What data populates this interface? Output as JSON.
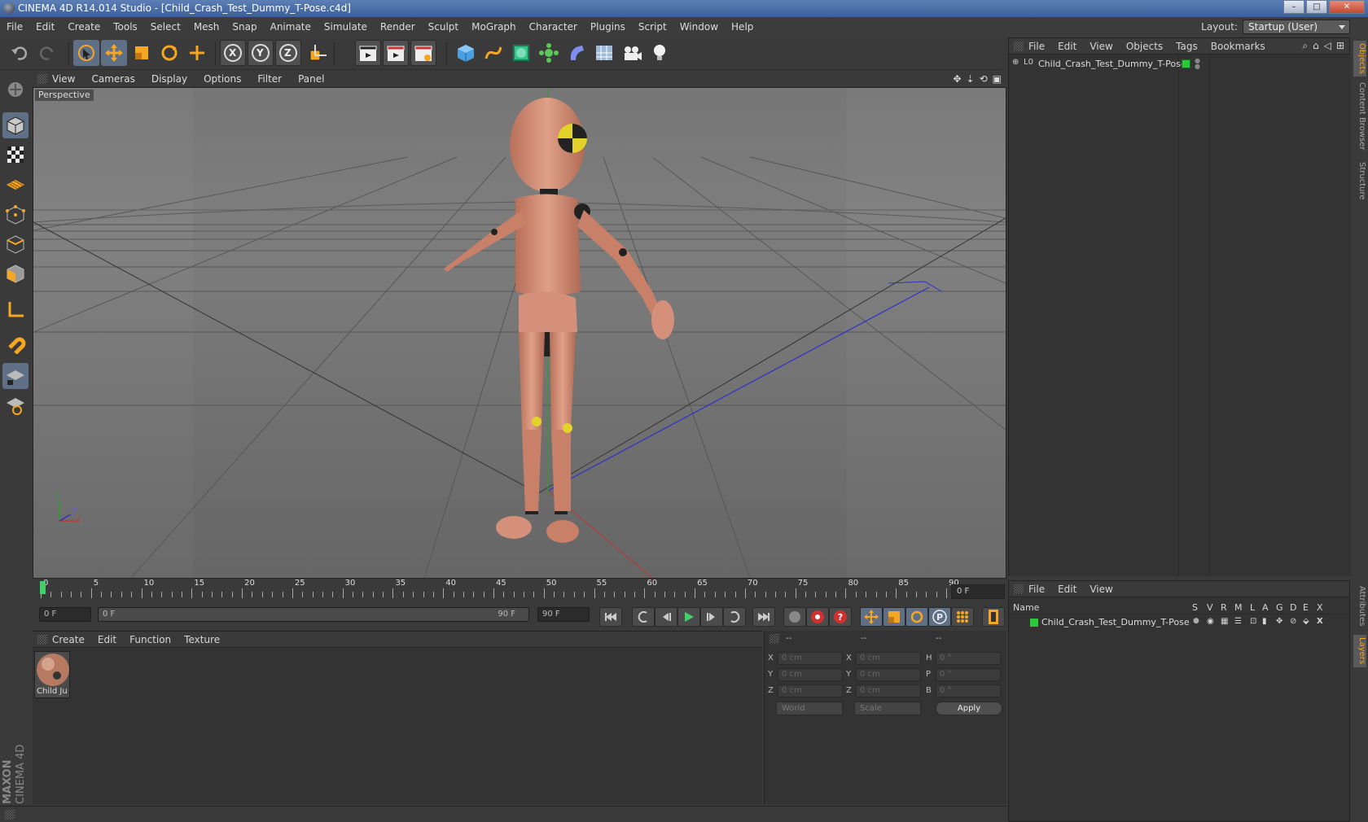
{
  "window": {
    "title": "CINEMA 4D R14.014 Studio - [Child_Crash_Test_Dummy_T-Pose.c4d]",
    "controls": [
      "–",
      "□",
      "✕"
    ]
  },
  "menubar": {
    "items": [
      "File",
      "Edit",
      "Create",
      "Tools",
      "Select",
      "Mesh",
      "Snap",
      "Animate",
      "Simulate",
      "Render",
      "Sculpt",
      "MoGraph",
      "Character",
      "Plugins",
      "Script",
      "Window",
      "Help"
    ],
    "layout_label": "Layout:",
    "layout_value": "Startup (User)"
  },
  "toolbar": {
    "axis_x": "X",
    "axis_y": "Y",
    "axis_z": "Z",
    "coord_p": "P"
  },
  "viewport": {
    "menu": [
      "View",
      "Cameras",
      "Display",
      "Options",
      "Filter",
      "Panel"
    ],
    "label": "Perspective",
    "axis_y": "Y",
    "axis_x": "X",
    "axis_z": "Z"
  },
  "timeline": {
    "ticks": [
      "0",
      "5",
      "10",
      "15",
      "20",
      "25",
      "30",
      "35",
      "40",
      "45",
      "50",
      "55",
      "60",
      "65",
      "70",
      "75",
      "80",
      "85",
      "90"
    ],
    "current_frame": "0 F"
  },
  "transport": {
    "start_frame": "0 F",
    "range_start": "0 F",
    "range_end": "90 F",
    "end_frame": "90 F"
  },
  "materials": {
    "menu": [
      "Create",
      "Edit",
      "Function",
      "Texture"
    ],
    "items": [
      {
        "name": "Child Ju"
      }
    ]
  },
  "coordinates": {
    "header": [
      "--",
      "--",
      "--"
    ],
    "rows": [
      {
        "a": "X",
        "a_val": "0 cm",
        "b": "X",
        "b_val": "0 cm",
        "c": "H",
        "c_val": "0 °"
      },
      {
        "a": "Y",
        "a_val": "0 cm",
        "b": "Y",
        "b_val": "0 cm",
        "c": "P",
        "c_val": "0 °"
      },
      {
        "a": "Z",
        "a_val": "0 cm",
        "b": "Z",
        "b_val": "0 cm",
        "c": "B",
        "c_val": "0 °"
      }
    ],
    "world": "World",
    "scale": "Scale",
    "apply": "Apply"
  },
  "objects": {
    "menu": [
      "File",
      "Edit",
      "View",
      "Objects",
      "Tags",
      "Bookmarks"
    ],
    "items": [
      {
        "name": "Child_Crash_Test_Dummy_T-Pose",
        "status_color": "#29c93a"
      }
    ]
  },
  "layers": {
    "menu": [
      "File",
      "Edit",
      "View"
    ],
    "columns": [
      "Name",
      "S",
      "V",
      "R",
      "M",
      "L",
      "A",
      "G",
      "D",
      "E",
      "X"
    ],
    "rows": [
      {
        "name": "Child_Crash_Test_Dummy_T-Pose",
        "color": "#29c93a"
      }
    ]
  },
  "right_tabs": [
    "Objects",
    "Content Browser",
    "Structure",
    "Attributes",
    "Layers"
  ],
  "brand": {
    "line1": "MAXON",
    "line2": "CINEMA 4D"
  },
  "colors": {
    "accent": "#f5a623",
    "active_tool": "#5f6f86",
    "viewport_bg": "#787878"
  }
}
